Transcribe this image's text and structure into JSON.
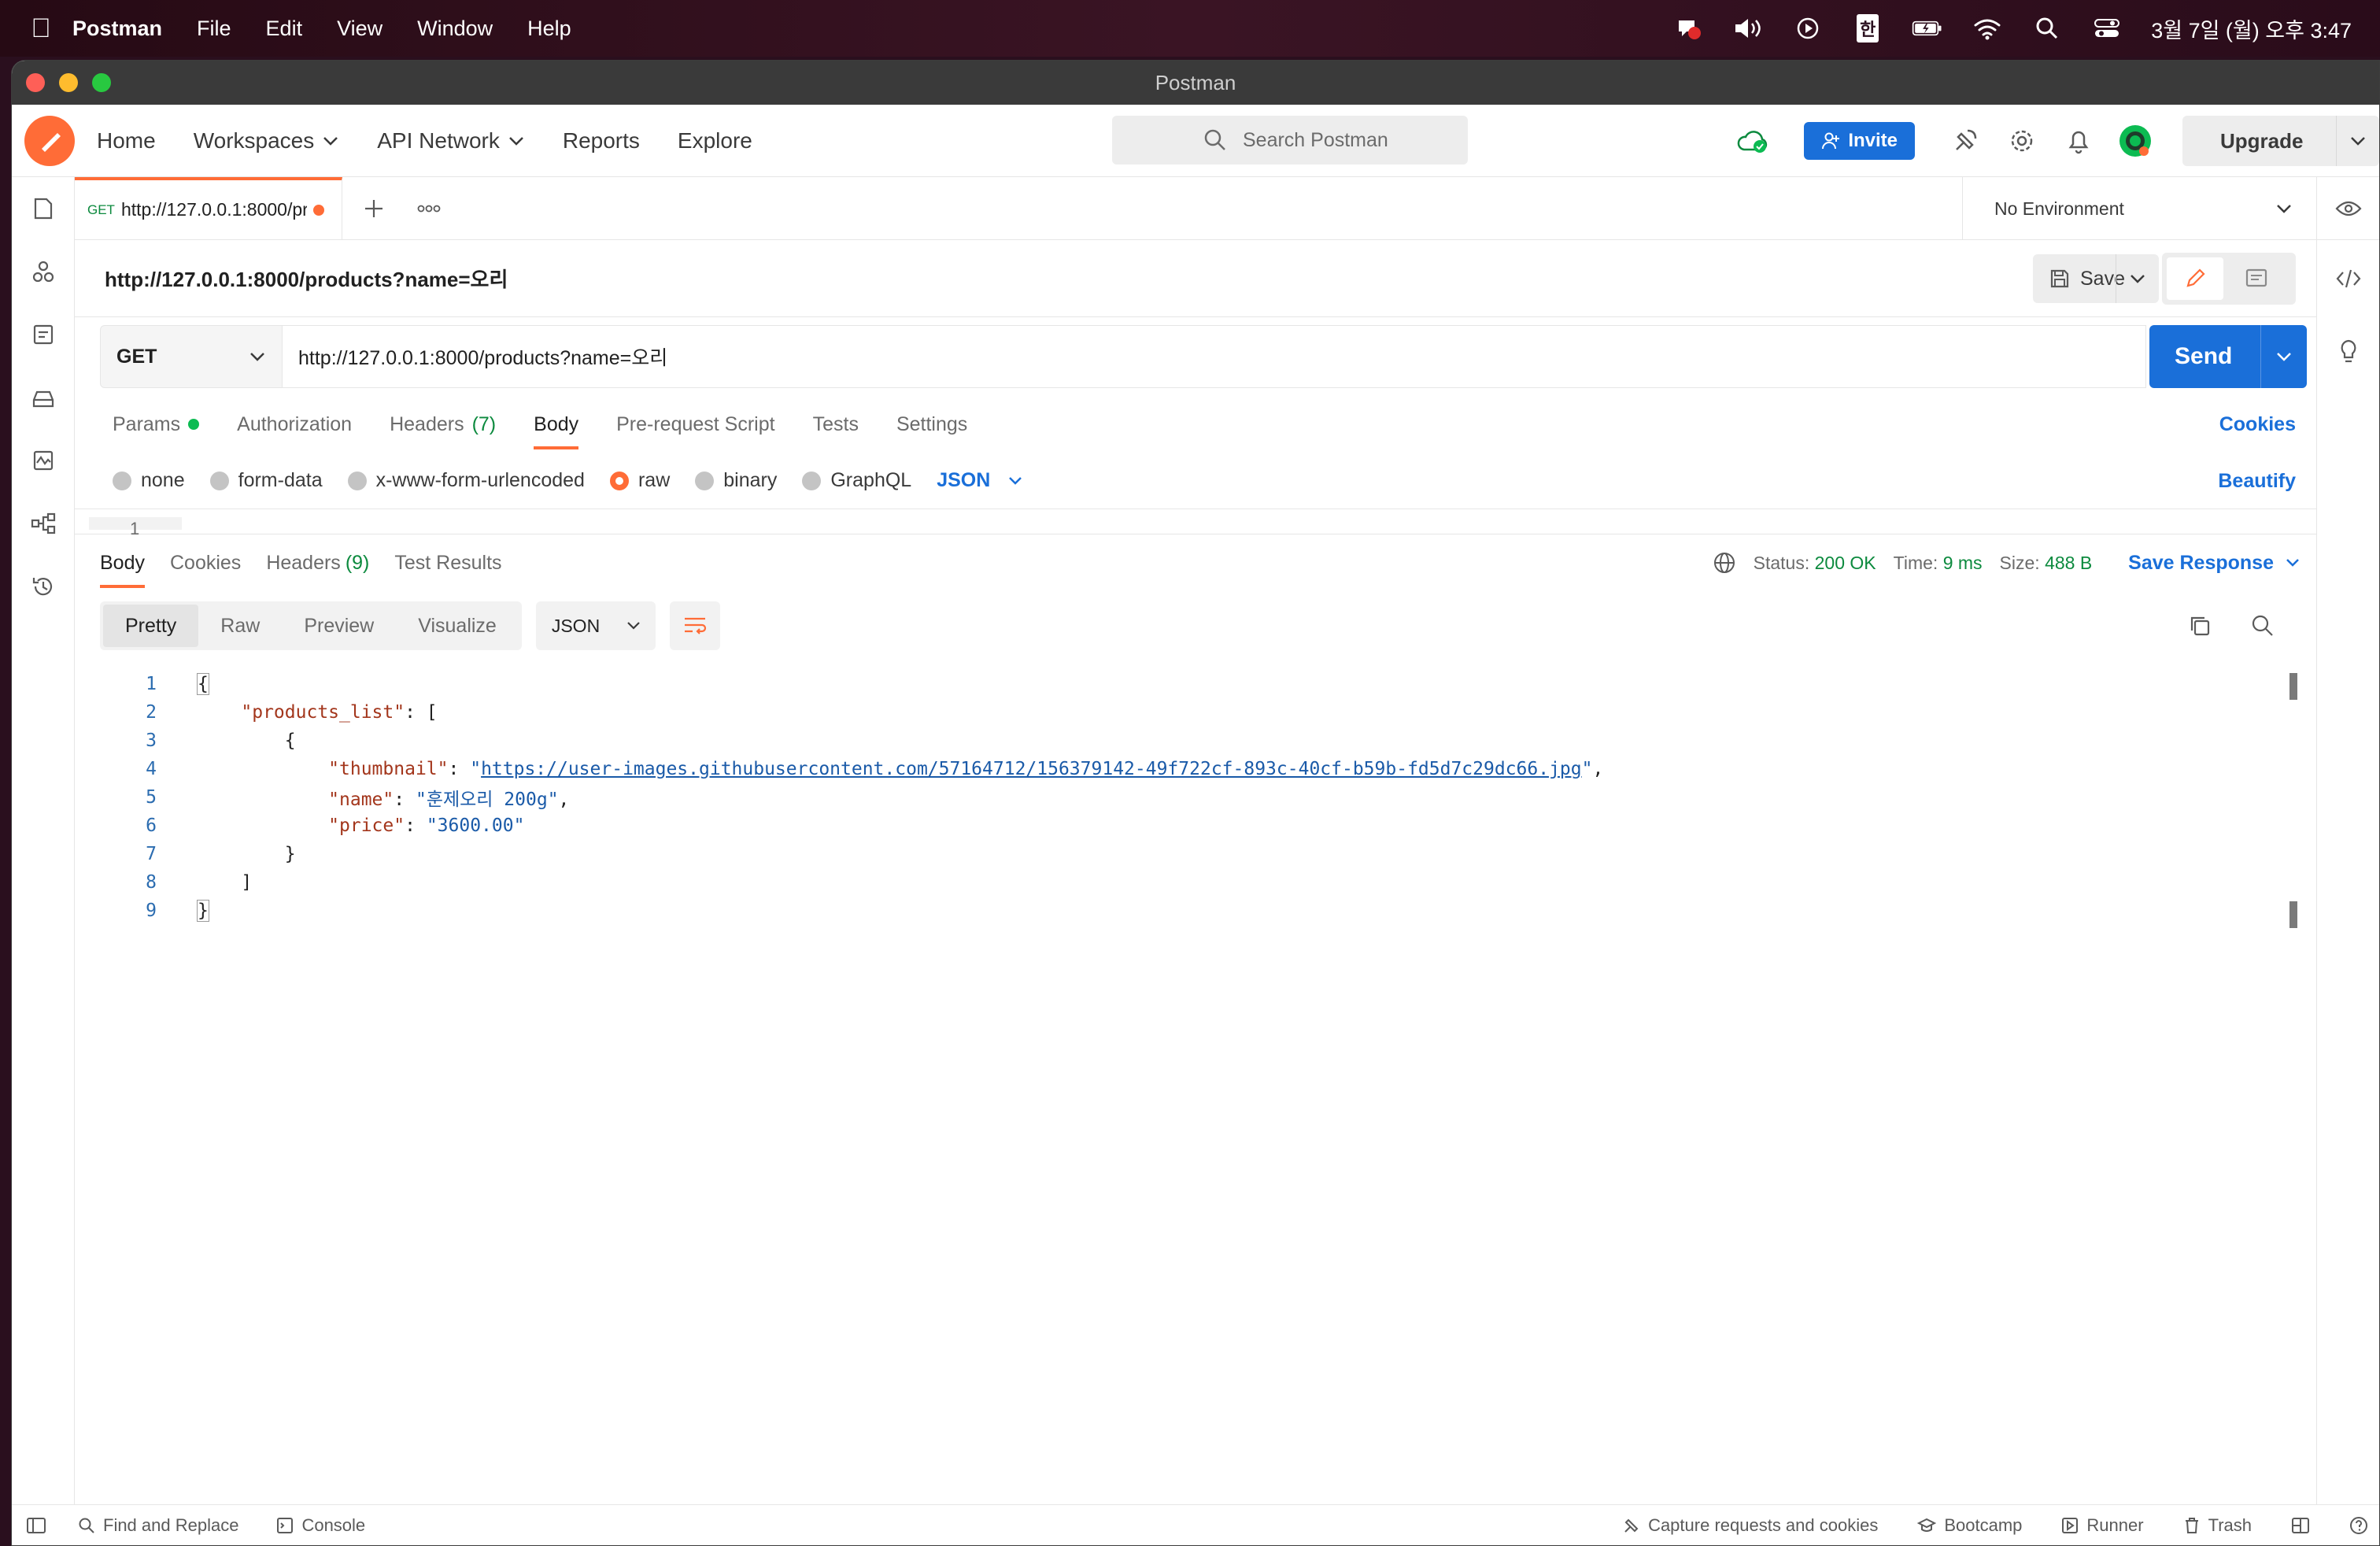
{
  "menubar": {
    "app": "Postman",
    "items": [
      "File",
      "Edit",
      "View",
      "Window",
      "Help"
    ],
    "clock": "3월 7일 (월) 오후 3:47",
    "input_method": "한"
  },
  "window": {
    "title": "Postman"
  },
  "topbar": {
    "nav": [
      "Home",
      "Workspaces",
      "API Network",
      "Reports",
      "Explore"
    ],
    "search_placeholder": "Search Postman",
    "invite_label": "Invite",
    "upgrade_label": "Upgrade"
  },
  "tabs": {
    "active_method": "GET",
    "active_url": "http://127.0.0.1:8000/pr",
    "environment": "No Environment"
  },
  "request": {
    "name": "http://127.0.0.1:8000/products?name=오리",
    "save_label": "Save",
    "method": "GET",
    "url": "http://127.0.0.1:8000/products?name=오리",
    "send_label": "Send",
    "tabs": {
      "params": "Params",
      "authorization": "Authorization",
      "headers": "Headers",
      "headers_count": "(7)",
      "body": "Body",
      "prerequest": "Pre-request Script",
      "tests": "Tests",
      "settings": "Settings"
    },
    "cookies_label": "Cookies",
    "body_types": {
      "none": "none",
      "form_data": "form-data",
      "urlencoded": "x-www-form-urlencoded",
      "raw": "raw",
      "binary": "binary",
      "graphql": "GraphQL"
    },
    "body_format": "JSON",
    "beautify_label": "Beautify",
    "editor_line": "1"
  },
  "response": {
    "tabs": {
      "body": "Body",
      "cookies": "Cookies",
      "headers": "Headers",
      "headers_count": "(9)",
      "test_results": "Test Results"
    },
    "status_label": "Status:",
    "status_value": "200 OK",
    "time_label": "Time:",
    "time_value": "9 ms",
    "size_label": "Size:",
    "size_value": "488 B",
    "save_response_label": "Save Response",
    "view_modes": [
      "Pretty",
      "Raw",
      "Preview",
      "Visualize"
    ],
    "format": "JSON",
    "code": {
      "line_numbers": [
        "1",
        "2",
        "3",
        "4",
        "5",
        "6",
        "7",
        "8",
        "9"
      ],
      "open_brace": "{",
      "key_products": "\"products_list\"",
      "colon_bracket": ": [",
      "inner_open": "{",
      "key_thumbnail": "\"thumbnail\"",
      "thumb_url": "https://user-images.githubusercontent.com/57164712/156379142-49f722cf-893c-40cf-b59b-fd5d7c29dc66.jpg",
      "key_name": "\"name\"",
      "val_name": "\"훈제오리 200g\"",
      "key_price": "\"price\"",
      "val_price": "\"3600.00\"",
      "inner_close": "}",
      "bracket_close": "]",
      "close_brace": "}"
    }
  },
  "statusbar": {
    "find_replace": "Find and Replace",
    "console": "Console",
    "capture": "Capture requests and cookies",
    "bootcamp": "Bootcamp",
    "runner": "Runner",
    "trash": "Trash"
  },
  "colors": {
    "accent": "#ff6c37",
    "primary": "#1a6fd9",
    "success": "#0c8a3e"
  }
}
